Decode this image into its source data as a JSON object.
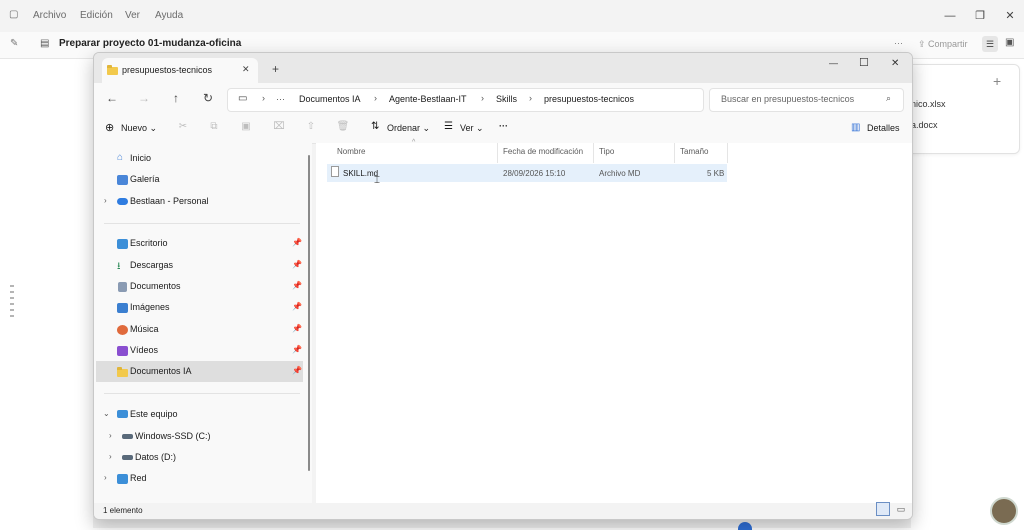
{
  "app_menu": {
    "items": [
      "Archivo",
      "Edición",
      "Ver",
      "Ayuda"
    ]
  },
  "app_toolbar": {
    "title": "Preparar proyecto 01-mudanza-oficina",
    "share_label": "Compartir",
    "more_label": "···"
  },
  "side_card": {
    "files": [
      "nico.xlsx",
      "a.docx"
    ],
    "add_label": "+"
  },
  "explorer": {
    "tab_title": "presupuestos-tecnicos",
    "tab_close": "✕",
    "tab_add": "+",
    "window_controls": {
      "minimize": "—",
      "maximize": "☐",
      "close": "✕"
    },
    "breadcrumb": [
      "Documentos IA",
      "Agente-Bestlaan-IT",
      "Skills",
      "presupuestos-tecnicos"
    ],
    "breadcrumb_ellipsis": "···",
    "search_placeholder": "Buscar en presupuestos-tecnicos",
    "commands": {
      "new": "Nuevo",
      "sort": "Ordenar",
      "view": "Ver",
      "more": "···",
      "details": "Detalles"
    },
    "nav": {
      "quick": [
        "Inicio",
        "Galería",
        "Bestlaan - Personal"
      ],
      "pinned": [
        "Escritorio",
        "Descargas",
        "Documentos",
        "Imágenes",
        "Música",
        "Vídeos",
        "Documentos IA"
      ],
      "pc": "Este equipo",
      "drives": [
        "Windows-SSD (C:)",
        "Datos (D:)"
      ],
      "network": "Red"
    },
    "columns": {
      "name": "Nombre",
      "modified": "Fecha de modificación",
      "type": "Tipo",
      "size": "Tamaño"
    },
    "files": [
      {
        "name": "SKILL.md",
        "modified": "28/09/2026 15:10",
        "type": "Archivo MD",
        "size": "5 KB"
      }
    ],
    "status": "1 elemento"
  },
  "colors": {
    "folder": "#f2c94c",
    "selection": "#e5f0fb",
    "nav_selected": "#dedede",
    "accent": "#2f6fd6"
  }
}
